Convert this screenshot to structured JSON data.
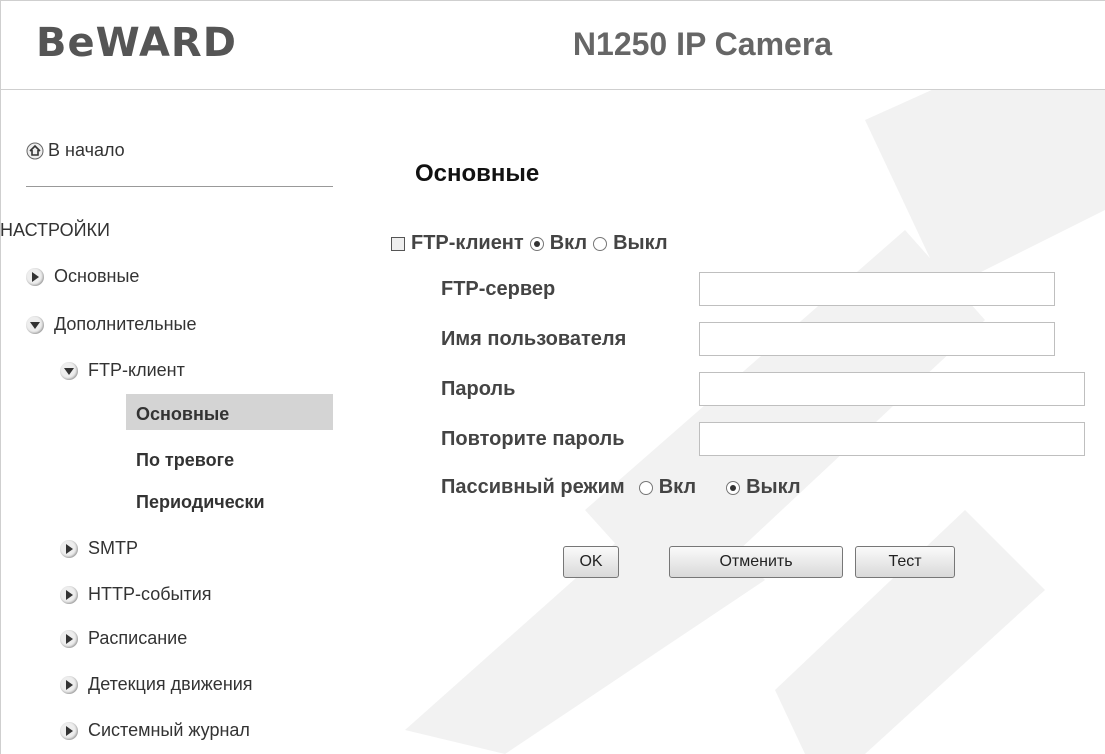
{
  "header": {
    "logo": "BeWARD",
    "title": "N1250 IP Camera"
  },
  "sidebar": {
    "home": "В начало",
    "section": "НАСТРОЙКИ",
    "items": [
      {
        "label": "Основные"
      },
      {
        "label": "Дополнительные"
      },
      {
        "label": "FTP-клиент"
      },
      {
        "label": "Основные"
      },
      {
        "label": "По тревоге"
      },
      {
        "label": "Периодически"
      },
      {
        "label": "SMTP"
      },
      {
        "label": "HTTP-события"
      },
      {
        "label": "Расписание"
      },
      {
        "label": "Детекция движения"
      },
      {
        "label": "Системный журнал"
      }
    ]
  },
  "main": {
    "title": "Основные",
    "ftp_client_label": "FTP-клиент",
    "on_label": "Вкл",
    "off_label": "Выкл",
    "ftp_server_label": "FTP-сервер",
    "username_label": "Имя пользователя",
    "password_label": "Пароль",
    "repeat_password_label": "Повторите пароль",
    "passive_label": "Пассивный режим",
    "ftp_server_value": "",
    "username_value": "",
    "password_value": "",
    "repeat_password_value": "",
    "ftp_client_state": "Вкл",
    "passive_state": "Выкл",
    "buttons": {
      "ok": "OK",
      "cancel": "Отменить",
      "test": "Тест"
    }
  }
}
